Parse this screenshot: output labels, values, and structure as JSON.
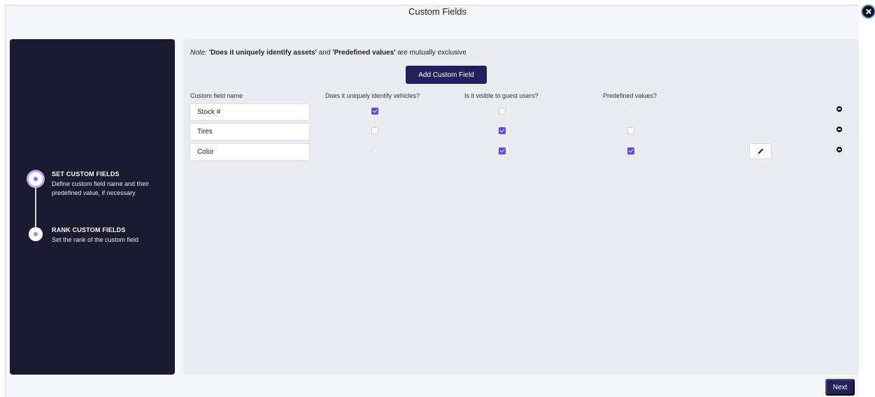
{
  "window": {
    "title": "Custom Fields",
    "close_icon": "close-circle-icon"
  },
  "sidebar": {
    "steps": [
      {
        "title": "SET CUSTOM FIELDS",
        "description": "Define custom field name and their predefined value, if necessary",
        "state": "active"
      },
      {
        "title": "RANK CUSTOM FIELDS",
        "description": "Set the rank of the custom field",
        "state": "pending"
      }
    ]
  },
  "main": {
    "note": {
      "prefix": "Note:",
      "part1": "'Does it uniquely identify assets'",
      "and": "and",
      "part2": "'Predefined values'",
      "suffix": "are mutually exclusive"
    },
    "add_button": "Add Custom Field",
    "columns": [
      "Custom field name",
      "Does it uniquely identify vehicles?",
      "Is it visible to guest users?",
      "Predefined values?"
    ],
    "rows": [
      {
        "name": "Stock #",
        "uniquely_identifies": "checked",
        "visible_to_guests": "unchecked",
        "predefined_values": "disabled",
        "has_edit": false
      },
      {
        "name": "Tires",
        "uniquely_identifies": "unchecked",
        "visible_to_guests": "checked",
        "predefined_values": "unchecked",
        "has_edit": false
      },
      {
        "name": "Color",
        "uniquely_identifies": "disabled",
        "visible_to_guests": "checked",
        "predefined_values": "checked",
        "has_edit": true
      }
    ]
  },
  "footer": {
    "next_button": "Next"
  },
  "colors": {
    "sidebar_bg": "#1b1a30",
    "primary_button": "#23205b",
    "checkbox_checked": "#5a48e8",
    "panel_bg": "#eaecf1"
  }
}
